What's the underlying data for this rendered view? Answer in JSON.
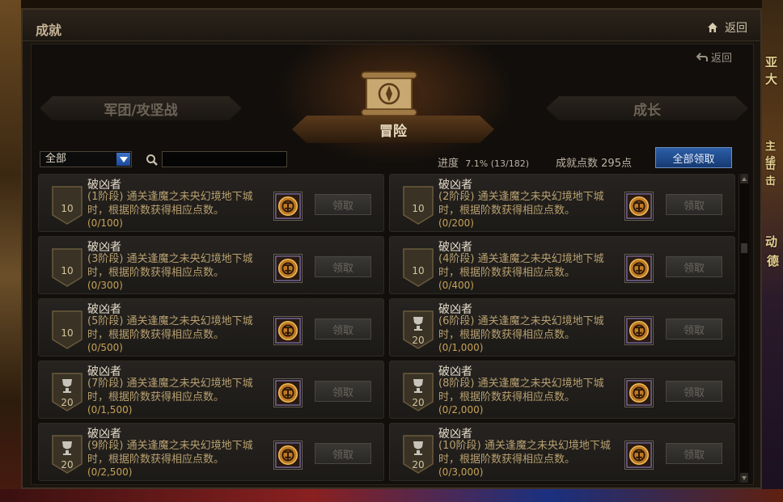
{
  "window": {
    "title": "成就",
    "home_label": "返回",
    "back_label": "返回"
  },
  "background": {
    "right_texts": [
      "亚大",
      "主线",
      "击击",
      "动",
      "德"
    ]
  },
  "tabs": {
    "left": "军团/攻坚战",
    "center": "冒险",
    "right": "成长",
    "active": "冒险"
  },
  "filter": {
    "selected": "全部",
    "search_placeholder": ""
  },
  "summary": {
    "progress_label": "进度",
    "progress_value": "7.1% (13/182)",
    "points_label": "成就点数",
    "points_value": "295点",
    "claim_all_label": "全部领取"
  },
  "achievements": [
    {
      "points": "10",
      "trophy": false,
      "name": "破凶者",
      "desc_stage": "(1阶段)",
      "desc": "通关逢魔之未央幻境地下城时，根据阶数获得相应点数。",
      "progress": "(0/100)",
      "claim": "领取"
    },
    {
      "points": "10",
      "trophy": false,
      "name": "破凶者",
      "desc_stage": "(2阶段)",
      "desc": "通关逢魔之未央幻境地下城时，根据阶数获得相应点数。",
      "progress": "(0/200)",
      "claim": "领取"
    },
    {
      "points": "10",
      "trophy": false,
      "name": "破凶者",
      "desc_stage": "(3阶段)",
      "desc": "通关逢魔之未央幻境地下城时，根据阶数获得相应点数。",
      "progress": "(0/300)",
      "claim": "领取"
    },
    {
      "points": "10",
      "trophy": false,
      "name": "破凶者",
      "desc_stage": "(4阶段)",
      "desc": "通关逢魔之未央幻境地下城时，根据阶数获得相应点数。",
      "progress": "(0/400)",
      "claim": "领取"
    },
    {
      "points": "10",
      "trophy": false,
      "name": "破凶者",
      "desc_stage": "(5阶段)",
      "desc": "通关逢魔之未央幻境地下城时，根据阶数获得相应点数。",
      "progress": "(0/500)",
      "claim": "领取"
    },
    {
      "points": "20",
      "trophy": true,
      "name": "破凶者",
      "desc_stage": "(6阶段)",
      "desc": "通关逢魔之未央幻境地下城时，根据阶数获得相应点数。",
      "progress": "(0/1,000)",
      "claim": "领取"
    },
    {
      "points": "20",
      "trophy": true,
      "name": "破凶者",
      "desc_stage": "(7阶段)",
      "desc": "通关逢魔之未央幻境地下城时，根据阶数获得相应点数。",
      "progress": "(0/1,500)",
      "claim": "领取"
    },
    {
      "points": "20",
      "trophy": true,
      "name": "破凶者",
      "desc_stage": "(8阶段)",
      "desc": "通关逢魔之未央幻境地下城时，根据阶数获得相应点数。",
      "progress": "(0/2,000)",
      "claim": "领取"
    },
    {
      "points": "20",
      "trophy": true,
      "name": "破凶者",
      "desc_stage": "(9阶段)",
      "desc": "通关逢魔之未央幻境地下城时，根据阶数获得相应点数。",
      "progress": "(0/2,500)",
      "claim": "领取"
    },
    {
      "points": "20",
      "trophy": true,
      "name": "破凶者",
      "desc_stage": "(10阶段)",
      "desc": "通关逢魔之未央幻境地下城时，根据阶数获得相应点数。",
      "progress": "(0/3,000)",
      "claim": "领取"
    }
  ],
  "colors": {
    "accent_blue": "#2b5ea8",
    "desc_gold": "#b8a070",
    "progress_gold": "#c7a257"
  }
}
